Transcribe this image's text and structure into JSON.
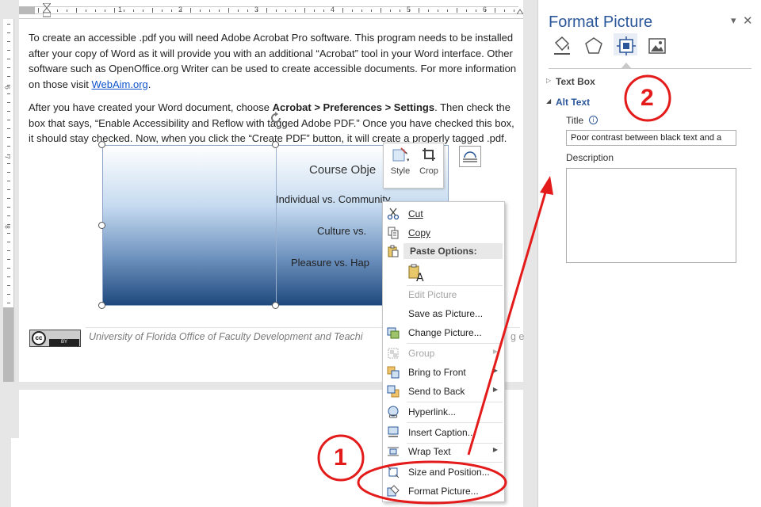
{
  "document": {
    "paragraph1_before": "To create an accessible .pdf you will need Adobe Acrobat Pro software.  This program needs to be installed after your copy of Word as it will provide you with an additional “Acrobat” tool in your Word interface.  Other software such as OpenOffice.org Writer can be used to create accessible documents.  For more information on those visit ",
    "paragraph1_link": "WebAim.org",
    "paragraph1_after": ".",
    "paragraph2_before": "After you have created your Word document, choose ",
    "paragraph2_bold": "Acrobat > Preferences > Settings",
    "paragraph2_after": ".  Then check the box that says, “Enable Accessibility and Reflow with tagged Adobe PDF.”  Once you have checked this box, it should stay checked.  Now, when you click the “Create PDF” button, it will create a properly tagged .pdf.",
    "footer_text": "University of Florida Office of Faculty Development and Teachi",
    "footer_fragment": "g e",
    "cc_label": "cc",
    "by_label": "BY"
  },
  "ruler": {
    "numbers": [
      "1",
      "2",
      "3",
      "4",
      "5",
      "6"
    ],
    "vertical_numbers": [
      "6",
      "7",
      "8"
    ]
  },
  "picture": {
    "title": "Course Obje",
    "line1": "Individual vs. Community",
    "line2": "Culture vs.",
    "line3": "Pleasure vs. Hap"
  },
  "mini_toolbar": {
    "style_label": "Style",
    "crop_label": "Crop"
  },
  "context_menu": {
    "cut": "Cut",
    "copy": "Copy",
    "paste_options": "Paste Options:",
    "edit_picture": "Edit Picture",
    "save_as_picture": "Save as Picture...",
    "change_picture": "Change Picture...",
    "group": "Group",
    "bring_to_front": "Bring to Front",
    "send_to_back": "Send to Back",
    "hyperlink": "Hyperlink...",
    "insert_caption": "Insert Caption...",
    "wrap_text": "Wrap Text",
    "size_and_position": "Size and Position...",
    "format_picture": "Format Picture..."
  },
  "panel": {
    "title": "Format Picture",
    "dropdown_glyph": "▾",
    "close_glyph": "✕",
    "text_box_label": "Text Box",
    "alt_text_label": "Alt Text",
    "title_label": "Title",
    "title_value": "Poor contrast between black text and a",
    "description_label": "Description",
    "description_value": "",
    "info_glyph": "i"
  },
  "annotations": {
    "step1": "1",
    "step2": "2",
    "color": "#e31b1b"
  },
  "colors": {
    "panel_accent": "#2b579a",
    "link": "#1155cc"
  }
}
